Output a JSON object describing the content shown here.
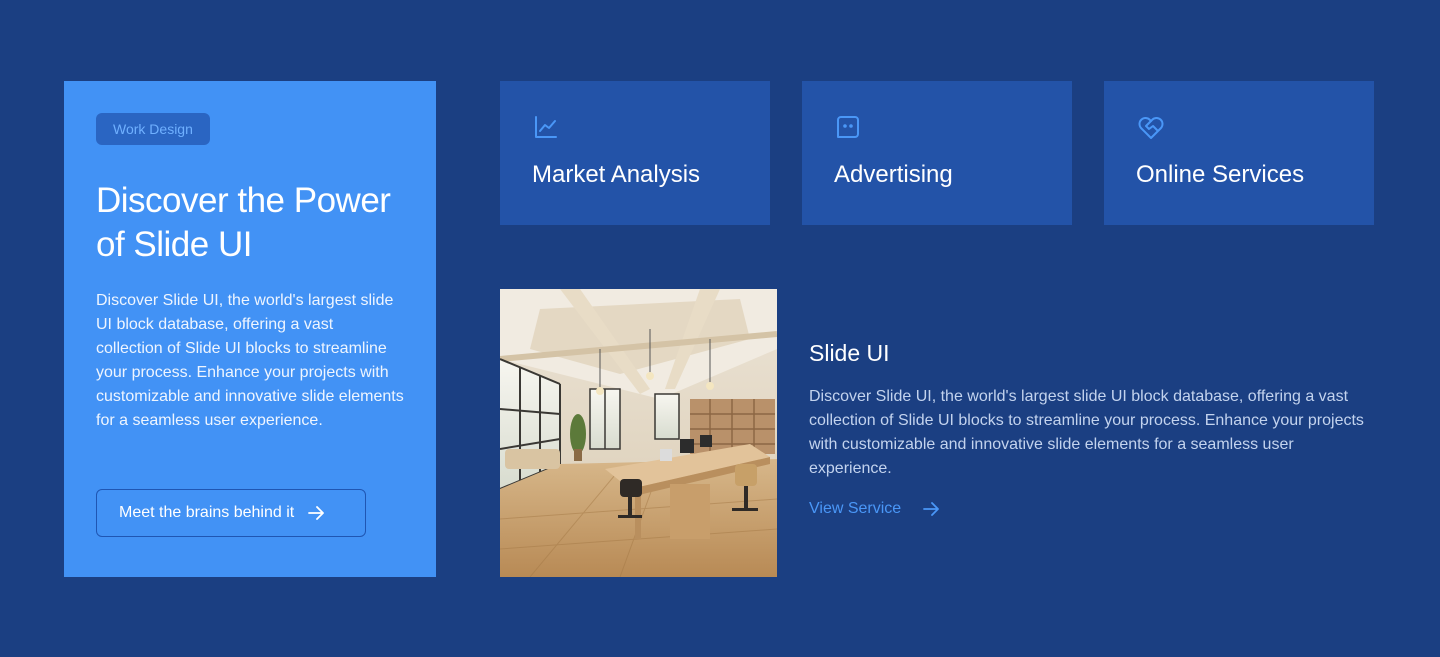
{
  "hero": {
    "badge": "Work Design",
    "title": "Discover the Power of Slide UI",
    "description": "Discover Slide UI, the world's largest slide UI block database, offering a vast collection of Slide UI blocks to streamline your process. Enhance your projects with customizable and innovative slide elements for a seamless user experience.",
    "button_label": "Meet the brains behind it",
    "button_icon": "arrow-right-icon"
  },
  "services": [
    {
      "label": "Market Analysis",
      "icon": "line-chart-icon"
    },
    {
      "label": "Advertising",
      "icon": "chat-face-icon"
    },
    {
      "label": "Online Services",
      "icon": "heart-handshake-icon"
    }
  ],
  "feature": {
    "title": "Slide UI",
    "description": "Discover Slide UI, the world's largest slide UI block database, offering a vast collection of Slide UI blocks to streamline your process. Enhance your projects with customizable and innovative slide elements for a seamless user experience.",
    "link_label": "View Service",
    "link_icon": "arrow-right-icon"
  },
  "colors": {
    "background": "#1b3f82",
    "hero_card": "#4292f5",
    "service_card": "#2353a8",
    "accent": "#4a97f7"
  }
}
